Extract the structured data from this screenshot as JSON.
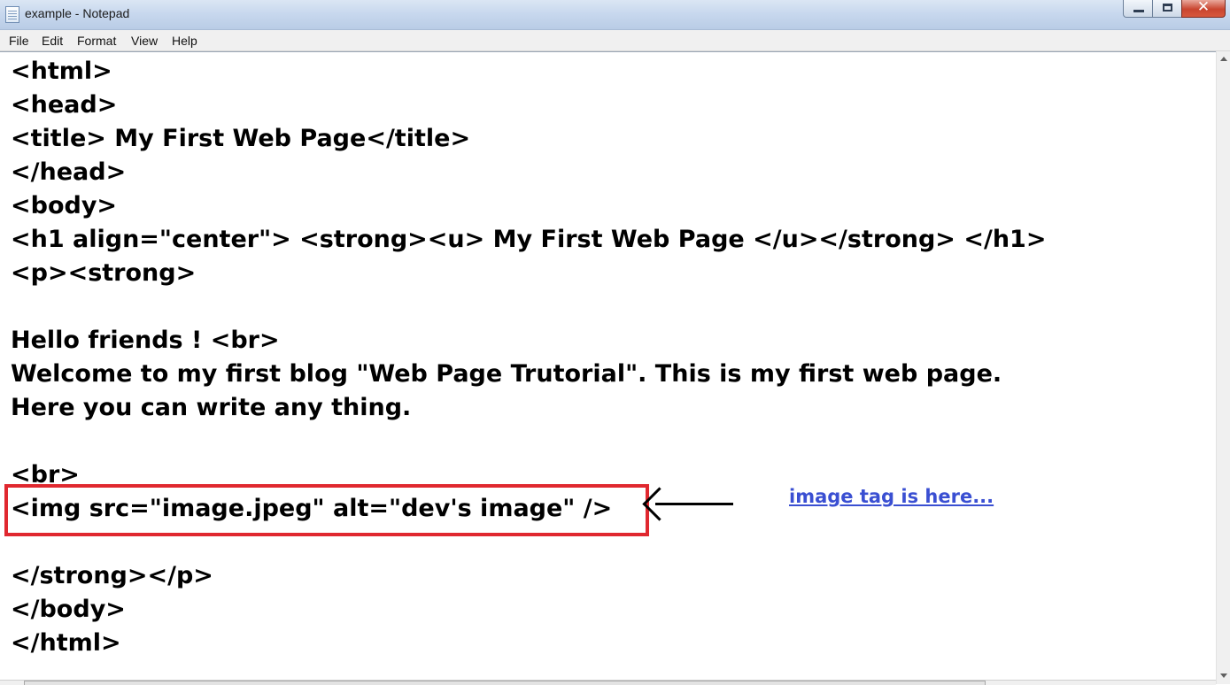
{
  "window": {
    "title": "example - Notepad",
    "close_glyph": "✕"
  },
  "menu": [
    "File",
    "Edit",
    "Format",
    "View",
    "Help"
  ],
  "editor": {
    "lines": [
      "<html>",
      "<head>",
      "<title> My First Web Page</title>",
      "</head>",
      "<body>",
      "<h1 align=\"center\"> <strong><u> My First Web Page </u></strong> </h1>",
      "<p><strong>",
      "",
      "Hello friends ! <br>",
      "Welcome to my first blog \"Web Page Trutorial\". This is my first web page.",
      "Here you can write any thing.",
      "",
      "<br>",
      "<img src=\"image.jpeg\" alt=\"dev's image\" />",
      "",
      "</strong></p>",
      "</body>",
      "</html>"
    ]
  },
  "annotation": {
    "text": "image tag is here...",
    "box_color": "#e0282f",
    "text_color": "#3a4fd2"
  }
}
